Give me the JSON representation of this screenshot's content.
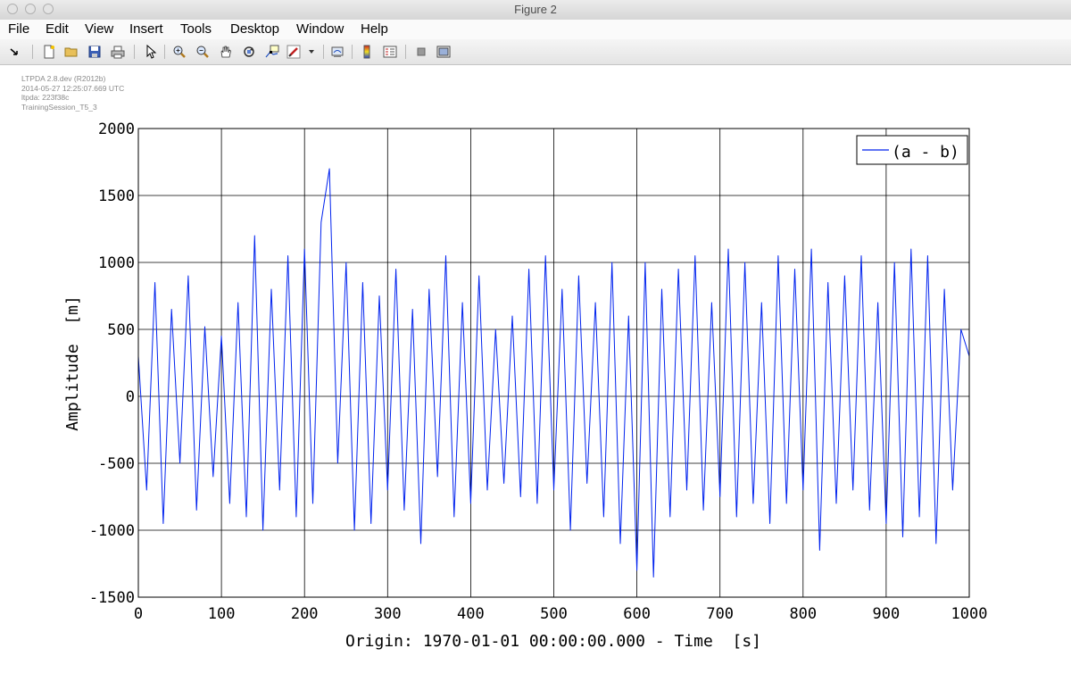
{
  "window": {
    "title": "Figure 2"
  },
  "menu": [
    "File",
    "Edit",
    "View",
    "Insert",
    "Tools",
    "Desktop",
    "Window",
    "Help"
  ],
  "toolbar": {
    "buttons": [
      {
        "name": "dock-arrow-button",
        "icon": "arrow-icon"
      },
      {
        "name": "new-figure-button",
        "icon": "new-file-icon"
      },
      {
        "name": "open-file-button",
        "icon": "folder-icon"
      },
      {
        "name": "save-button",
        "icon": "floppy-icon"
      },
      {
        "name": "print-button",
        "icon": "printer-icon"
      },
      {
        "name": "edit-plot-button",
        "icon": "pointer-icon"
      },
      {
        "name": "zoom-in-button",
        "icon": "zoom-in-icon"
      },
      {
        "name": "zoom-out-button",
        "icon": "zoom-out-icon"
      },
      {
        "name": "pan-button",
        "icon": "hand-icon"
      },
      {
        "name": "rotate-3d-button",
        "icon": "rotate-icon"
      },
      {
        "name": "data-cursor-button",
        "icon": "data-cursor-icon"
      },
      {
        "name": "brush-button",
        "icon": "brush-icon"
      },
      {
        "name": "brush-dropdown-button",
        "icon": "chevron-down-icon"
      },
      {
        "name": "link-plot-button",
        "icon": "link-icon"
      },
      {
        "name": "colorbar-button",
        "icon": "colorbar-icon"
      },
      {
        "name": "legend-button",
        "icon": "legend-icon"
      },
      {
        "name": "hide-plot-tools-button",
        "icon": "square-icon"
      },
      {
        "name": "show-plot-tools-button",
        "icon": "window-icon"
      }
    ]
  },
  "metadata": {
    "lines": [
      "LTPDA 2.8.dev (R2012b)",
      "2014-05-27 12:25:07.669 UTC",
      "ltpda: 223f38c",
      "TrainingSession_T5_3"
    ]
  },
  "chart_data": {
    "type": "line",
    "title": "",
    "xlabel": "Origin: 1970-01-01 00:00:00.000 - Time  [s]",
    "ylabel": "Amplitude  [m]",
    "xlim": [
      0,
      1000
    ],
    "ylim": [
      -1500,
      2000
    ],
    "xticks": [
      "0",
      "100",
      "200",
      "300",
      "400",
      "500",
      "600",
      "700",
      "800",
      "900",
      "1000"
    ],
    "yticks": [
      "-1500",
      "-1000",
      "-500",
      "0",
      "500",
      "1000",
      "1500",
      "2000"
    ],
    "grid": true,
    "legend_position": "top-right",
    "series": [
      {
        "name": "(a - b)",
        "color": "#0022ee",
        "x": [
          0,
          10,
          20,
          30,
          40,
          50,
          60,
          70,
          80,
          90,
          100,
          110,
          120,
          130,
          140,
          150,
          160,
          170,
          180,
          190,
          200,
          210,
          220,
          230,
          240,
          250,
          260,
          270,
          280,
          290,
          300,
          310,
          320,
          330,
          340,
          350,
          360,
          370,
          380,
          390,
          400,
          410,
          420,
          430,
          440,
          450,
          460,
          470,
          480,
          490,
          500,
          510,
          520,
          530,
          540,
          550,
          560,
          570,
          580,
          590,
          600,
          610,
          620,
          630,
          640,
          650,
          660,
          670,
          680,
          690,
          700,
          710,
          720,
          730,
          740,
          750,
          760,
          770,
          780,
          790,
          800,
          810,
          820,
          830,
          840,
          850,
          860,
          870,
          880,
          890,
          900,
          910,
          920,
          930,
          940,
          950,
          960,
          970,
          980,
          990,
          1000
        ],
        "y": [
          300,
          -700,
          850,
          -950,
          650,
          -500,
          900,
          -850,
          520,
          -600,
          450,
          -800,
          700,
          -900,
          1200,
          -1000,
          800,
          -700,
          1050,
          -900,
          1100,
          -800,
          1300,
          1700,
          -500,
          1000,
          -1000,
          850,
          -950,
          750,
          -700,
          950,
          -850,
          650,
          -1100,
          800,
          -600,
          1050,
          -900,
          700,
          -800,
          900,
          -700,
          500,
          -650,
          600,
          -750,
          950,
          -800,
          1050,
          -700,
          800,
          -1000,
          900,
          -650,
          700,
          -900,
          1000,
          -1100,
          600,
          -1300,
          1000,
          -1350,
          800,
          -900,
          950,
          -700,
          1050,
          -850,
          700,
          -750,
          1100,
          -900,
          1000,
          -800,
          700,
          -950,
          1050,
          -800,
          950,
          -700,
          1100,
          -1150,
          850,
          -800,
          900,
          -700,
          1050,
          -850,
          700,
          -950,
          1000,
          -1050,
          1100,
          -900,
          1050,
          -1100,
          800,
          -700,
          500,
          300
        ]
      }
    ]
  }
}
